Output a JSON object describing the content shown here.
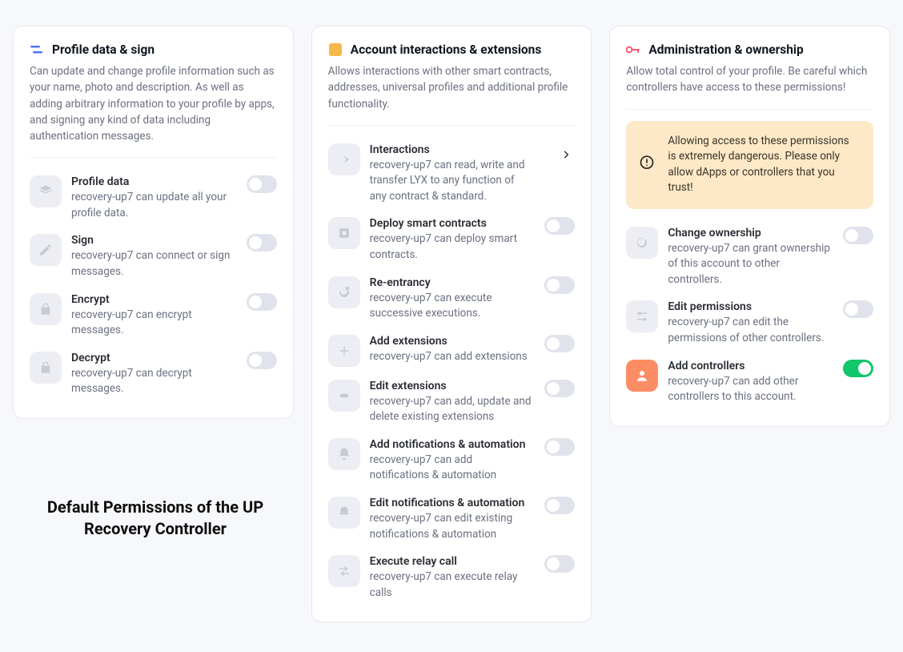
{
  "caption": "Default Permissions of the UP Recovery Controller",
  "cards": {
    "profile": {
      "title": "Profile data & sign",
      "desc": "Can update and change profile information such as your name, photo and description. As well as adding arbitrary information to your profile by apps, and signing any kind of data including authentication messages.",
      "items": [
        {
          "title": "Profile data",
          "desc": "recovery-up7 can update all your profile data.",
          "on": false
        },
        {
          "title": "Sign",
          "desc": "recovery-up7 can connect or sign messages.",
          "on": false
        },
        {
          "title": "Encrypt",
          "desc": "recovery-up7 can encrypt messages.",
          "on": false
        },
        {
          "title": "Decrypt",
          "desc": "recovery-up7 can decrypt messages.",
          "on": false
        }
      ]
    },
    "account": {
      "title": "Account interactions & extensions",
      "desc": "Allows interactions with other smart contracts, addresses, universal profiles and additional profile functionality.",
      "items": [
        {
          "title": "Interactions",
          "desc": "recovery-up7 can read, write and transfer LYX to any function of any contract & standard.",
          "chevron": true
        },
        {
          "title": "Deploy smart contracts",
          "desc": "recovery-up7 can deploy smart contracts.",
          "on": false
        },
        {
          "title": "Re-entrancy",
          "desc": "recovery-up7 can execute successive executions.",
          "on": false
        },
        {
          "title": "Add extensions",
          "desc": "recovery-up7 can add extensions",
          "on": false
        },
        {
          "title": "Edit extensions",
          "desc": "recovery-up7 can add, update and delete existing extensions",
          "on": false
        },
        {
          "title": "Add notifications & automation",
          "desc": "recovery-up7 can add notifications & automation",
          "on": false
        },
        {
          "title": "Edit notifications & automation",
          "desc": "recovery-up7 can edit existing notifications & automation",
          "on": false
        },
        {
          "title": "Execute relay call",
          "desc": "recovery-up7 can execute relay calls",
          "on": false
        }
      ]
    },
    "admin": {
      "title": "Administration & ownership",
      "desc": "Allow total control of your profile. Be careful which controllers have access to these permissions!",
      "warning": "Allowing access to these permissions is extremely dangerous. Please only allow dApps or controllers that you trust!",
      "items": [
        {
          "title": "Change ownership",
          "desc": "recovery-up7 can grant ownership of this account to other controllers.",
          "on": false
        },
        {
          "title": "Edit permissions",
          "desc": "recovery-up7 can edit the permissions of other controllers.",
          "on": false
        },
        {
          "title": "Add controllers",
          "desc": "recovery-up7 can add other controllers to this account.",
          "on": true,
          "danger": true
        }
      ]
    }
  }
}
